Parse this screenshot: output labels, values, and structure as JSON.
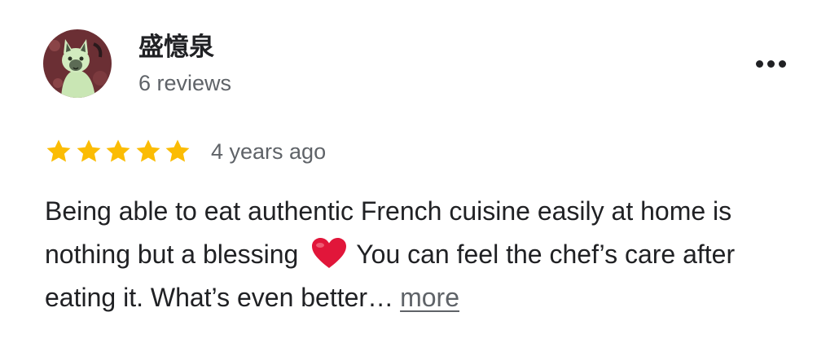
{
  "reviewer": {
    "name": "盛憶泉",
    "review_count": "6 reviews"
  },
  "review": {
    "rating": 5,
    "max_rating": 5,
    "date": "4 years ago",
    "text_before_emoji": "Being able to eat authentic French cuisine easily at home is nothing but a blessing",
    "emoji": "heart-emoji",
    "text_after_emoji": "You can feel the chef’s care after eating it. What’s even better…",
    "more_label": "more"
  },
  "colors": {
    "star": "#FBBC04",
    "text": "#202124",
    "secondary_text": "#5f6368",
    "heart": "#E1163A"
  },
  "icons": [
    "avatar-cat",
    "more-options-icon",
    "star-icon",
    "heart-emoji"
  ]
}
